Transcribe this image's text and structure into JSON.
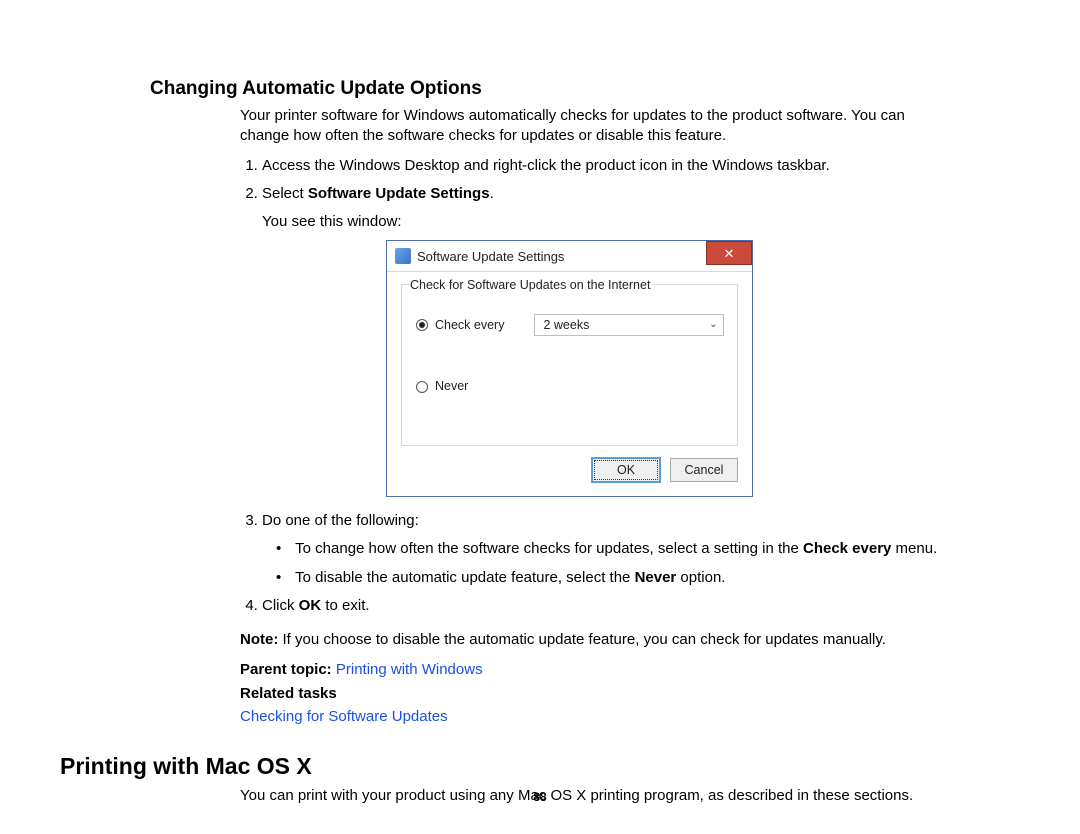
{
  "section1": {
    "title": "Changing Automatic Update Options",
    "intro": "Your printer software for Windows automatically checks for updates to the product software. You can change how often the software checks for updates or disable this feature.",
    "step1": "Access the Windows Desktop and right-click the product icon in the Windows taskbar.",
    "step2_pre": "Select ",
    "step2_bold": "Software Update Settings",
    "step2_post": ".",
    "step2_after": "You see this window:",
    "step3_lead": "Do one of the following:",
    "bullet1_pre": "To change how often the software checks for updates, select a setting in the ",
    "bullet1_bold": "Check every",
    "bullet1_post": " menu.",
    "bullet2_pre": "To disable the automatic update feature, select the ",
    "bullet2_bold": "Never",
    "bullet2_post": " option.",
    "step4_pre": "Click ",
    "step4_bold": "OK",
    "step4_post": " to exit.",
    "note_label": "Note:",
    "note_text": " If you choose to disable the automatic update feature, you can check for updates manually.",
    "parent_label": "Parent topic: ",
    "parent_link": "Printing with Windows",
    "related_label": "Related tasks",
    "related_link": "Checking for Software Updates"
  },
  "dialog": {
    "title": "Software Update Settings",
    "close_glyph": "✕",
    "legend": "Check for Software Updates on the Internet",
    "radio_check_label": "Check every",
    "dropdown_value": "2 weeks",
    "radio_never_label": "Never",
    "ok": "OK",
    "cancel": "Cancel"
  },
  "section2": {
    "title": "Printing with Mac OS X",
    "intro": "You can print with your product using any Mac OS X printing program, as described in these sections."
  },
  "page_number": "88"
}
